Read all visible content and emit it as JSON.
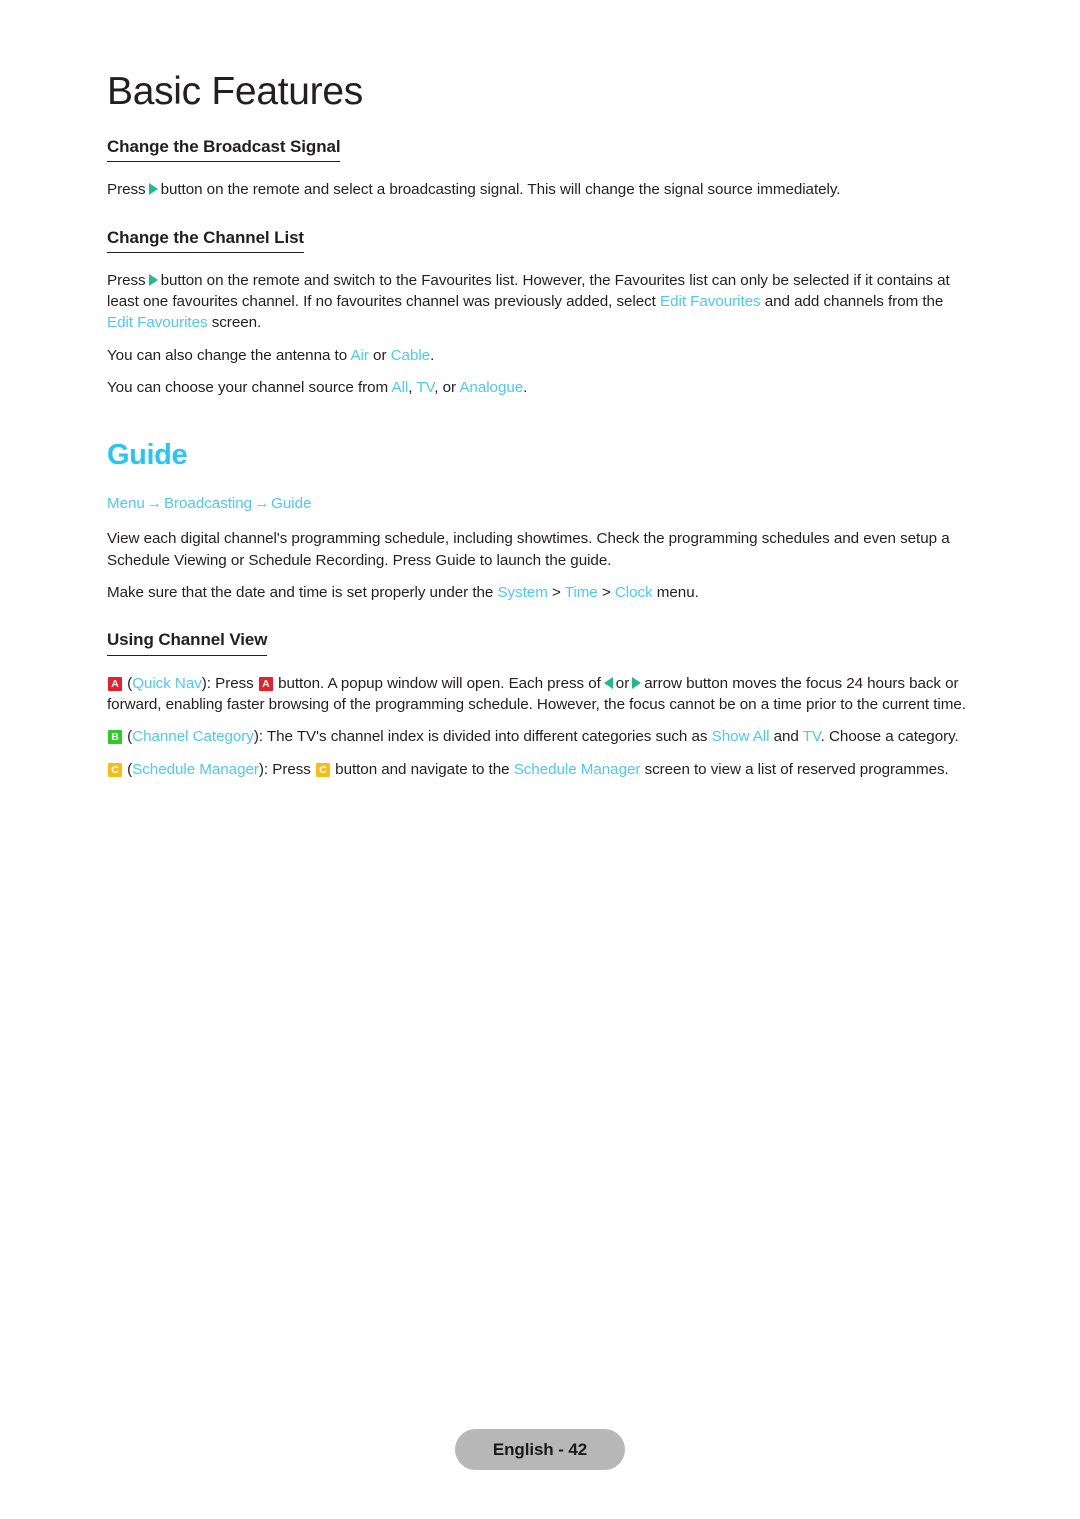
{
  "page": {
    "chapter_title": "Basic Features",
    "footer_label": "English - 42"
  },
  "colors": {
    "link_blue": "#4cc9f5",
    "heading_blue": "#29c5f6",
    "arrow_green": "#22b893",
    "badge_a_red": "#e8202e",
    "badge_b_green": "#2ecc23",
    "badge_c_yellow": "#f6bf18",
    "footer_gray": "#b7b7b7",
    "body_text": "#231f20"
  },
  "sections": {
    "broadcast_signal": {
      "heading": "Change the Broadcast Signal",
      "p1_a": "Press",
      "p1_b": "button on the remote and select a broadcasting signal. This will change the signal source immediately."
    },
    "channel_list": {
      "heading": "Change the Channel List",
      "p1_a": "Press",
      "p1_b": "button on the remote and switch to the Favourites list. However, the Favourites list can only be selected if it contains at least one favourites channel. If no favourites channel was previously added, select",
      "p1_term1": "Edit Favourites",
      "p1_c": "and add channels from the",
      "p1_term2": "Edit Favourites",
      "p1_d": "screen.",
      "p2_a": "You can also change the antenna to",
      "p2_term1": "Air",
      "p2_b": "or",
      "p2_term2": "Cable",
      "p2_c": ".",
      "p3_a": "You can choose your channel source from",
      "p3_term1": "All",
      "p3_b": ",",
      "p3_term2": "TV",
      "p3_c": ", or",
      "p3_term3": "Analogue",
      "p3_d": "."
    },
    "guide": {
      "heading": "Guide",
      "breadcrumb": {
        "item1": "Menu",
        "sep1": "→",
        "item2": "Broadcasting",
        "sep2": "→",
        "item3": "Guide"
      },
      "p1": "View each digital channel's programming schedule, including showtimes. Check the programming schedules and even setup a Schedule Viewing or Schedule Recording. Press Guide to launch the guide.",
      "p2_a": "Make sure that the date and time is set properly under the",
      "p2_term1": "System",
      "p2_gt1": ">",
      "p2_term2": "Time",
      "p2_gt2": ">",
      "p2_term3": "Clock",
      "p2_b": "menu."
    },
    "channel_view": {
      "heading": "Using Channel View",
      "item_a": {
        "badge": "A",
        "open_paren": "(",
        "term": "Quick Nav",
        "close_paren": "):",
        "t1": "Press",
        "badge2": "A",
        "t2": "button. A popup window will open. Each press of",
        "t3": "or",
        "t4": "arrow button moves the focus 24 hours back or forward, enabling faster browsing of the programming schedule. However, the focus cannot be on a time prior to the current time."
      },
      "item_b": {
        "badge": "B",
        "open_paren": "(",
        "term": "Channel Category",
        "close_paren": "):",
        "t1": "The TV's channel index is divided into different categories such as",
        "term2": "Show All",
        "t2": "and",
        "term3": "TV",
        "t3": ". Choose a category."
      },
      "item_c": {
        "badge": "C",
        "open_paren": "(",
        "term": "Schedule Manager",
        "close_paren": "):",
        "t1": "Press",
        "badge2": "C",
        "t2": "button and navigate to the",
        "term2": "Schedule Manager",
        "t3": "screen to view a list of reserved programmes."
      }
    }
  }
}
